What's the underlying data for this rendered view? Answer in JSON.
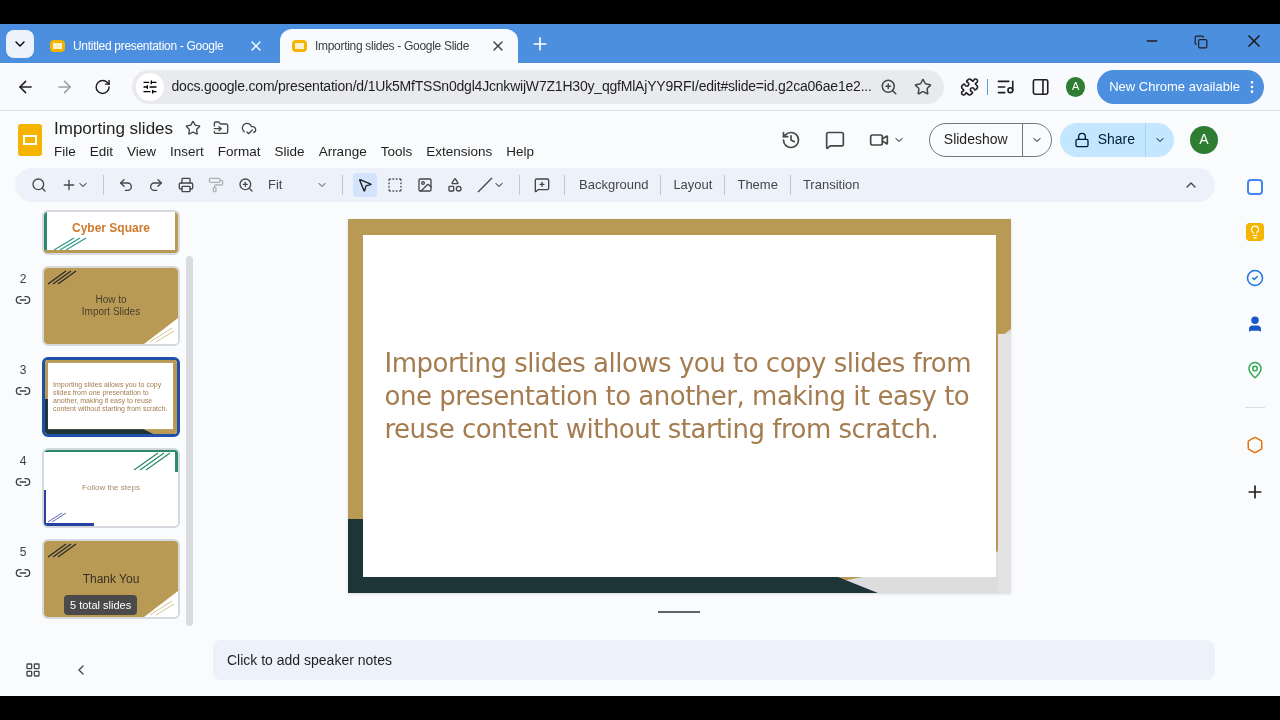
{
  "browser": {
    "tabs": [
      {
        "title": "Untitled presentation - Google",
        "selected": false
      },
      {
        "title": "Importing slides - Google Slide",
        "selected": true
      }
    ],
    "address": "docs.google.com/presentation/d/1Uk5MfTSSn0dgl4JcnkwijW7Z1H30y_qgfMlAjYY9RFI/edit#slide=id.g2ca06ae1e2...",
    "profile_initial": "A",
    "update_button": "New Chrome available"
  },
  "document": {
    "title": "Importing slides",
    "menus": [
      "File",
      "Edit",
      "View",
      "Insert",
      "Format",
      "Slide",
      "Arrange",
      "Tools",
      "Extensions",
      "Help"
    ],
    "slideshow_button": "Slideshow",
    "share_button": "Share",
    "account_initial": "A"
  },
  "toolbar": {
    "zoom": "Fit",
    "buttons": [
      "Background",
      "Layout",
      "Theme",
      "Transition"
    ]
  },
  "slides": [
    {
      "kind": "logo",
      "text": "Cyber Square",
      "selected": false
    },
    {
      "number": "2",
      "kind": "gold",
      "text": "How to\nImport Slides",
      "selected": false
    },
    {
      "number": "3",
      "kind": "body",
      "text": "Importing slides allows you to copy slides from one presentation to another, making it easy to reuse content without starting from scratch.",
      "selected": true
    },
    {
      "number": "4",
      "kind": "plain",
      "text": "Follow the steps",
      "selected": false
    },
    {
      "number": "5",
      "kind": "gold",
      "text": "Thank You",
      "selected": false
    }
  ],
  "slide_count_badge": "5 total slides",
  "canvas": {
    "text": "Importing slides allows you to copy slides from one presentation to another, making it easy to reuse content without starting from scratch."
  },
  "speaker_notes": {
    "placeholder": "Click to add speaker notes"
  }
}
